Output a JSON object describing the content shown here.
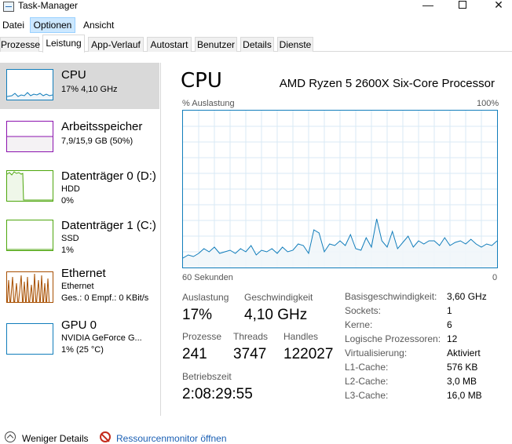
{
  "window": {
    "title": "Task-Manager",
    "minimize": "—",
    "close": "✕"
  },
  "menu": [
    "Datei",
    "Optionen",
    "Ansicht"
  ],
  "tabs": [
    "Prozesse",
    "Leistung",
    "App-Verlauf",
    "Autostart",
    "Benutzer",
    "Details",
    "Dienste"
  ],
  "sidebar": [
    {
      "title": "CPU",
      "line1": "17%  4,10 GHz",
      "line2": "",
      "color": "#117dbb",
      "fill": "#f1f6fa"
    },
    {
      "title": "Arbeitsspeicher",
      "line1": "7,9/15,9 GB (50%)",
      "line2": "",
      "color": "#8b12ae",
      "fill": "#f4f2f4"
    },
    {
      "title": "Datenträger 0 (D:)",
      "line1": "HDD",
      "line2": "0%",
      "color": "#4da60c",
      "fill": "#eff7e9"
    },
    {
      "title": "Datenträger 1 (C:)",
      "line1": "SSD",
      "line2": "1%",
      "color": "#4da60c",
      "fill": "#eff7e9"
    },
    {
      "title": "Ethernet",
      "line1": "Ethernet",
      "line2": "Ges.: 0  Empf.: 0 KBit/s",
      "color": "#a74f01",
      "fill": "#fcf3eb"
    },
    {
      "title": "GPU 0",
      "line1": "NVIDIA GeForce G...",
      "line2": "1%  (25 °C)",
      "color": "#117dbb",
      "fill": "#f1f6fa"
    }
  ],
  "main": {
    "title": "CPU",
    "processor": "AMD Ryzen 5 2600X Six-Core Processor",
    "graph_label_left": "% Auslastung",
    "graph_label_right": "100%",
    "time_label_left": "60 Sekunden",
    "time_label_right": "0",
    "stats": {
      "util_label": "Auslastung",
      "util_value": "17%",
      "speed_label": "Geschwindigkeit",
      "speed_value": "4,10 GHz",
      "proc_label": "Prozesse",
      "proc_value": "241",
      "threads_label": "Threads",
      "threads_value": "3747",
      "handles_label": "Handles",
      "handles_value": "122027",
      "uptime_label": "Betriebszeit",
      "uptime_value": "2:08:29:55"
    },
    "details": [
      {
        "key": "Basisgeschwindigkeit:",
        "value": "3,60 GHz"
      },
      {
        "key": "Sockets:",
        "value": "1"
      },
      {
        "key": "Kerne:",
        "value": "6"
      },
      {
        "key": "Logische Prozessoren:",
        "value": "12"
      },
      {
        "key": "Virtualisierung:",
        "value": "Aktiviert"
      },
      {
        "key": "L1-Cache:",
        "value": "576 KB"
      },
      {
        "key": "L2-Cache:",
        "value": "3,0 MB"
      },
      {
        "key": "L3-Cache:",
        "value": "16,0 MB"
      }
    ]
  },
  "footer": {
    "fewer_details": "Weniger Details",
    "open_resmon": "Ressourcenmonitor öffnen"
  },
  "colors": {
    "cpu_line": "#117dbb",
    "cpu_fill": "#f1f6fa",
    "grid": "#d9eaf4",
    "selected_bg": "#d9d9d9"
  },
  "chart_data": {
    "type": "area",
    "title": "CPU",
    "xlabel": "60 Sekunden",
    "ylabel": "% Auslastung",
    "xlim": [
      60,
      0
    ],
    "ylim": [
      0,
      100
    ],
    "grid": true,
    "x": [
      60,
      59,
      58,
      57,
      56,
      55,
      54,
      53,
      52,
      51,
      50,
      49,
      48,
      47,
      46,
      45,
      44,
      43,
      42,
      41,
      40,
      39,
      38,
      37,
      36,
      35,
      34,
      33,
      32,
      31,
      30,
      29,
      28,
      27,
      26,
      25,
      24,
      23,
      22,
      21,
      20,
      19,
      18,
      17,
      16,
      15,
      14,
      13,
      12,
      11,
      10,
      9,
      8,
      7,
      6,
      5,
      4,
      3,
      2,
      1,
      0
    ],
    "series": [
      {
        "values": [
          6,
          8,
          7,
          9,
          12,
          10,
          13,
          9,
          10,
          11,
          9,
          12,
          10,
          14,
          8,
          11,
          10,
          12,
          9,
          13,
          10,
          11,
          15,
          14,
          9,
          24,
          22,
          10,
          15,
          14,
          17,
          14,
          21,
          12,
          11,
          19,
          13,
          31,
          17,
          13,
          23,
          12,
          16,
          20,
          13,
          17,
          15,
          17,
          17,
          14,
          19,
          14,
          16,
          17,
          15,
          18,
          15,
          13,
          15,
          14,
          17
        ]
      }
    ]
  }
}
